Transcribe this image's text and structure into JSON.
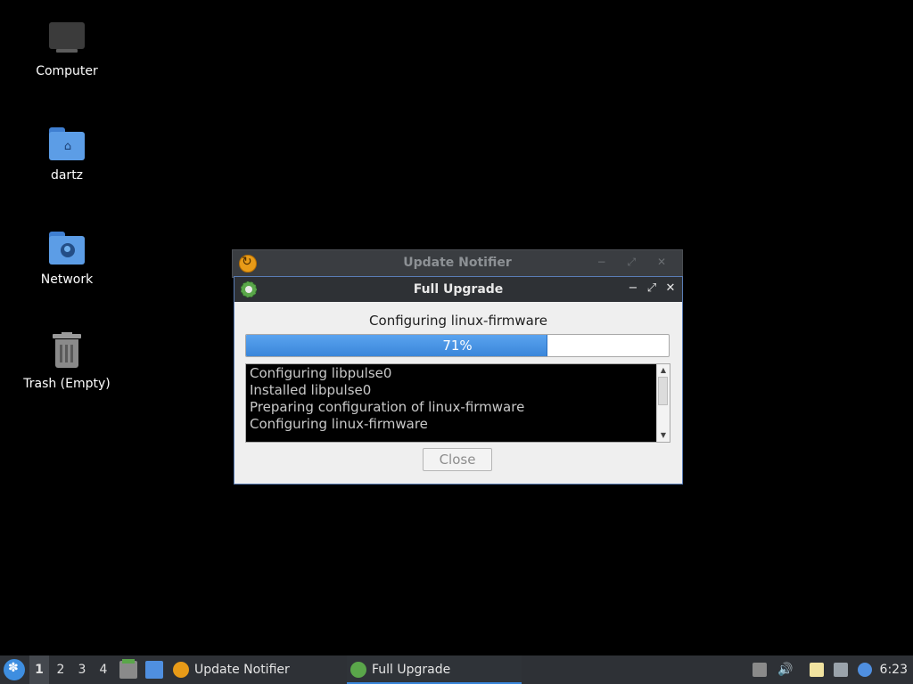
{
  "desktop": {
    "icons": [
      {
        "label": "Computer"
      },
      {
        "label": "dartz"
      },
      {
        "label": "Network"
      },
      {
        "label": "Trash (Empty)"
      }
    ]
  },
  "background_window": {
    "title": "Update Notifier"
  },
  "dialog": {
    "title": "Full Upgrade",
    "status": "Configuring linux-firmware",
    "progress_label": "71%",
    "progress_value": 0.71,
    "log_lines": [
      "Configuring libpulse0",
      "Installed libpulse0",
      "Preparing configuration of linux-firmware",
      "Configuring linux-firmware"
    ],
    "close_button": "Close",
    "controls": {
      "minimize": "−",
      "maximize": "⤢",
      "close": "✕"
    }
  },
  "taskbar": {
    "workspaces": [
      "1",
      "2",
      "3",
      "4"
    ],
    "active_workspace": "1",
    "tasks": [
      {
        "label": "Update Notifier",
        "icon": "update-notifier-icon",
        "active": false
      },
      {
        "label": "Full Upgrade",
        "icon": "gear-icon",
        "active": true
      }
    ],
    "clock": "6:23"
  },
  "colors": {
    "accent": "#3a86da",
    "desktop_bg": "#000000"
  }
}
